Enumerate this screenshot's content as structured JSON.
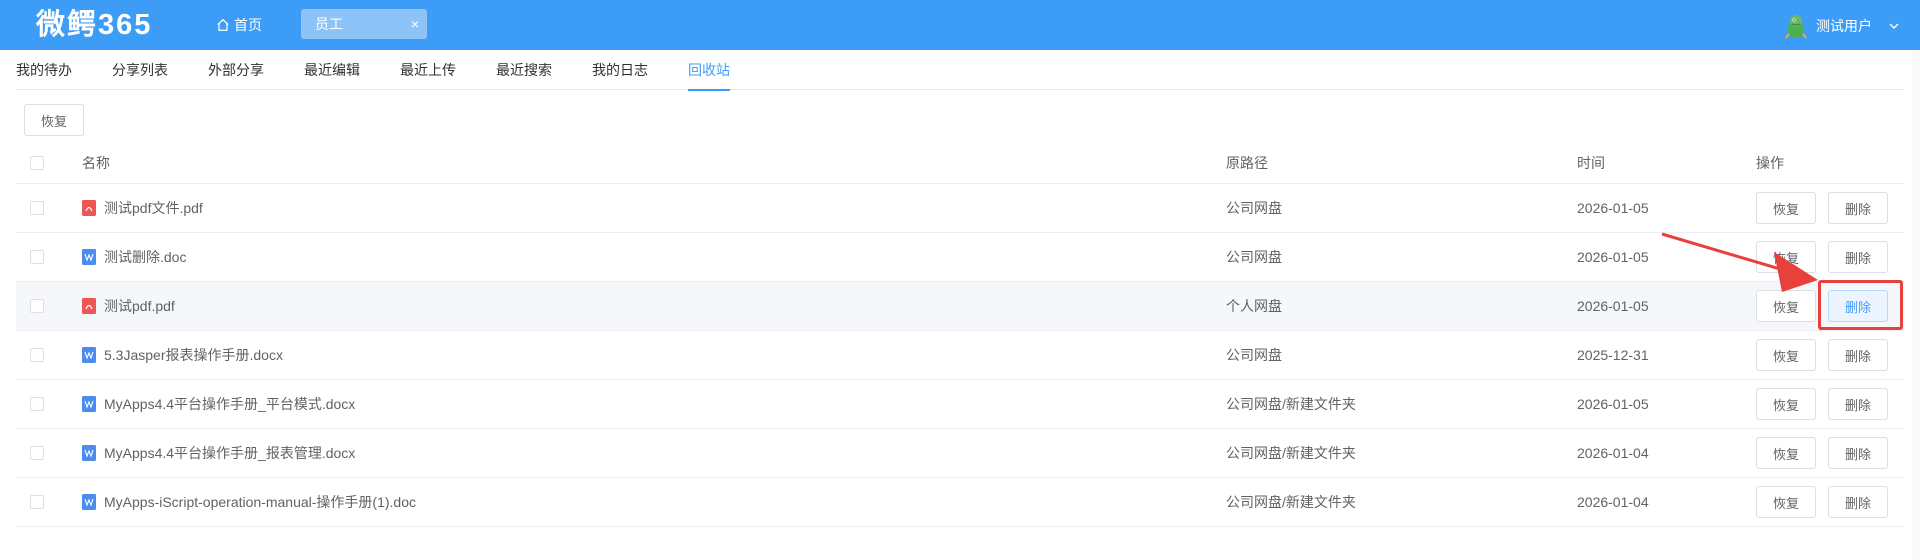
{
  "header": {
    "logo": "微鳄365",
    "home_label": "首页",
    "tab_label": "员工",
    "tab_close": "×",
    "user_name": "测试用户"
  },
  "subtabs": [
    {
      "label": "我的待办",
      "active": false
    },
    {
      "label": "分享列表",
      "active": false
    },
    {
      "label": "外部分享",
      "active": false
    },
    {
      "label": "最近编辑",
      "active": false
    },
    {
      "label": "最近上传",
      "active": false
    },
    {
      "label": "最近搜索",
      "active": false
    },
    {
      "label": "我的日志",
      "active": false
    },
    {
      "label": "回收站",
      "active": true
    }
  ],
  "toolbar": {
    "restore_label": "恢复"
  },
  "table": {
    "columns": {
      "name": "名称",
      "path": "原路径",
      "time": "时间",
      "ops": "操作"
    },
    "restore_label": "恢复",
    "delete_label": "删除",
    "rows": [
      {
        "type": "pdf",
        "name": "测试pdf文件.pdf",
        "path": "公司网盘",
        "time": "2026-01-05"
      },
      {
        "type": "doc",
        "name": "测试删除.doc",
        "path": "公司网盘",
        "time": "2026-01-05"
      },
      {
        "type": "pdf",
        "name": "测试pdf.pdf",
        "path": "个人网盘",
        "time": "2026-01-05"
      },
      {
        "type": "doc",
        "name": "5.3Jasper报表操作手册.docx",
        "path": "公司网盘",
        "time": "2025-12-31"
      },
      {
        "type": "doc",
        "name": "MyApps4.4平台操作手册_平台模式.docx",
        "path": "公司网盘/新建文件夹",
        "time": "2026-01-05"
      },
      {
        "type": "doc",
        "name": "MyApps4.4平台操作手册_报表管理.docx",
        "path": "公司网盘/新建文件夹",
        "time": "2026-01-04"
      },
      {
        "type": "doc",
        "name": "MyApps-iScript-operation-manual-操作手册(1).doc",
        "path": "公司网盘/新建文件夹",
        "time": "2026-01-04"
      }
    ]
  },
  "colors": {
    "header_bg": "#3d9df6",
    "accent": "#409eff",
    "annotation": "#e8413c",
    "pdf_icon": "#f05454",
    "doc_icon": "#4a8cf0"
  }
}
